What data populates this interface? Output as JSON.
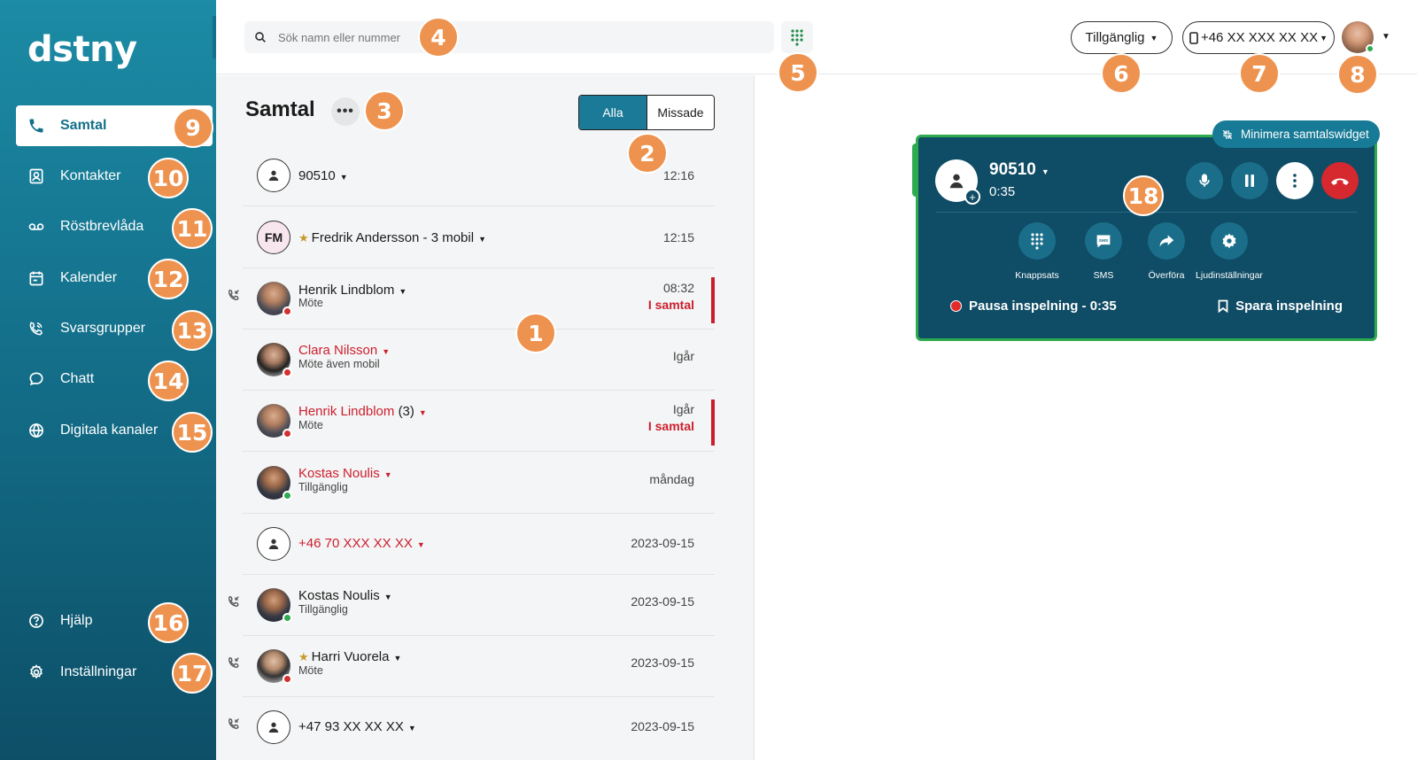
{
  "app": {
    "logo": "dstny"
  },
  "sidebar": {
    "items": [
      {
        "label": "Samtal",
        "icon": "phone-icon"
      },
      {
        "label": "Kontakter",
        "icon": "contact-card-icon"
      },
      {
        "label": "Röstbrevlåda",
        "icon": "voicemail-icon"
      },
      {
        "label": "Kalender",
        "icon": "calendar-icon"
      },
      {
        "label": "Svarsgrupper",
        "icon": "answer-group-icon"
      },
      {
        "label": "Chatt",
        "icon": "chat-bubble-icon"
      },
      {
        "label": "Digitala kanaler",
        "icon": "globe-icon"
      },
      {
        "label": "Hjälp",
        "icon": "help-icon"
      },
      {
        "label": "Inställningar",
        "icon": "settings-gear-icon"
      }
    ]
  },
  "search": {
    "placeholder": "Sök namn eller nummer"
  },
  "topbar": {
    "status": "Tillgänglig",
    "phone_number": "+46 XX XXX XX XX"
  },
  "calls": {
    "title": "Samtal",
    "filters": [
      "Alla",
      "Missade"
    ],
    "rows": [
      {
        "name": "90510",
        "sub": "",
        "time": "12:16",
        "status_text": ""
      },
      {
        "initials": "FM",
        "name": "Fredrik Andersson - 3 mobil",
        "sub": "",
        "time": "12:15",
        "status_text": ""
      },
      {
        "name": "Henrik Lindblom",
        "sub": "Möte",
        "time": "08:32",
        "status_text": "I samtal"
      },
      {
        "name": "Clara Nilsson",
        "sub": "Möte även mobil",
        "time": "Igår",
        "status_text": ""
      },
      {
        "name": "Henrik Lindblom",
        "count": "(3)",
        "sub": "Möte",
        "time": "Igår",
        "status_text": "I samtal"
      },
      {
        "name": "Kostas Noulis",
        "sub": "Tillgänglig",
        "time": "måndag",
        "status_text": ""
      },
      {
        "name": "+46 70 XXX XX XX",
        "sub": "",
        "time": "2023-09-15",
        "status_text": ""
      },
      {
        "name": "Kostas Noulis",
        "sub": "Tillgänglig",
        "time": "2023-09-15",
        "status_text": ""
      },
      {
        "name": "Harri Vuorela",
        "sub": "Möte",
        "time": "2023-09-15",
        "status_text": ""
      },
      {
        "name": "+47 93 XX XX XX",
        "sub": "",
        "time": "2023-09-15",
        "status_text": ""
      }
    ]
  },
  "widget": {
    "minimize_label": "Minimera samtalswidget",
    "number": "90510",
    "duration": "0:35",
    "tools": [
      "Knappsats",
      "SMS",
      "Överföra",
      "Ljudinställningar"
    ],
    "recording_label": "Pausa inspelning - 0:35",
    "save_recording_label": "Spara inspelning"
  },
  "badges": [
    "1",
    "2",
    "3",
    "4",
    "5",
    "6",
    "7",
    "8",
    "9",
    "10",
    "11",
    "12",
    "13",
    "14",
    "15",
    "16",
    "17",
    "18"
  ],
  "colors": {
    "brand": "#14708b",
    "accent": "#1b7a98",
    "widget_bg": "#0f4c65",
    "badge": "#ee934f",
    "missed_red": "#cc1f2d",
    "available_green": "#2eaa4f"
  }
}
